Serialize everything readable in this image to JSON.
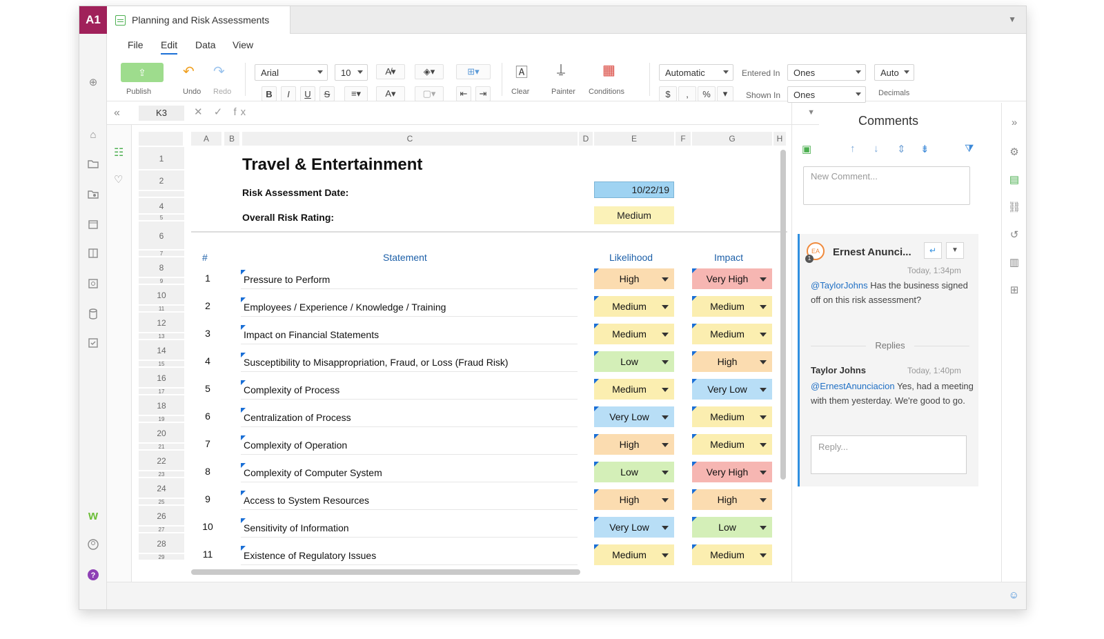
{
  "app": {
    "logo": "A1",
    "doc_title": "Planning and Risk Assessments"
  },
  "menu": [
    "File",
    "Edit",
    "Data",
    "View"
  ],
  "toolbar": {
    "publish": "Publish",
    "undo": "Undo",
    "redo": "Redo",
    "font": "Arial",
    "font_size": "10",
    "clear": "Clear",
    "painter": "Painter",
    "conditions": "Conditions",
    "format": "Automatic",
    "entered_in_label": "Entered In",
    "entered_in_value": "Ones",
    "shown_in_label": "Shown In",
    "shown_in_value": "Ones",
    "decimals_value": "Auto",
    "decimals_label": "Decimals",
    "bold": "B",
    "italic": "I",
    "underline": "U",
    "strike": "S",
    "currency": "$",
    "comma": ",",
    "percent": "%"
  },
  "formula": {
    "cell_ref": "K3",
    "icons": "✕ ✓ fx"
  },
  "columns": [
    "A",
    "B",
    "C",
    "D",
    "E",
    "F",
    "G",
    "H"
  ],
  "row_numbers": [
    "1",
    "2",
    "",
    "4",
    "5",
    "6",
    "7",
    "8",
    "9",
    "10",
    "11",
    "12",
    "13",
    "14",
    "15",
    "16",
    "17",
    "18",
    "19",
    "20",
    "21",
    "22",
    "23",
    "24",
    "25",
    "26",
    "27",
    "28",
    "29"
  ],
  "sheet": {
    "title": "Travel & Entertainment",
    "date_label": "Risk Assessment Date:",
    "date_value": "10/22/19",
    "rating_label": "Overall Risk Rating:",
    "rating_value": "Medium",
    "headers": {
      "num": "#",
      "statement": "Statement",
      "likelihood": "Likelihood",
      "impact": "Impact"
    },
    "rows": [
      {
        "n": "1",
        "s": "Pressure to Perform",
        "l": "High",
        "i": "Very High"
      },
      {
        "n": "2",
        "s": "Employees / Experience / Knowledge / Training",
        "l": "Medium",
        "i": "Medium"
      },
      {
        "n": "3",
        "s": "Impact on Financial Statements",
        "l": "Medium",
        "i": "Medium"
      },
      {
        "n": "4",
        "s": "Susceptibility to Misappropriation, Fraud, or Loss (Fraud Risk)",
        "l": "Low",
        "i": "High"
      },
      {
        "n": "5",
        "s": "Complexity of Process",
        "l": "Medium",
        "i": "Very Low"
      },
      {
        "n": "6",
        "s": "Centralization of Process",
        "l": "Very Low",
        "i": "Medium"
      },
      {
        "n": "7",
        "s": "Complexity of Operation",
        "l": "High",
        "i": "Medium"
      },
      {
        "n": "8",
        "s": "Complexity of Computer System",
        "l": "Low",
        "i": "Very High"
      },
      {
        "n": "9",
        "s": "Access to System Resources",
        "l": "High",
        "i": "High"
      },
      {
        "n": "10",
        "s": "Sensitivity of Information",
        "l": "Very Low",
        "i": "Low"
      },
      {
        "n": "11",
        "s": "Existence of Regulatory Issues",
        "l": "Medium",
        "i": "Medium"
      }
    ]
  },
  "level_colors": {
    "Very High": "#f6b6b2",
    "High": "#fbdcb0",
    "Medium": "#fbeeb0",
    "Low": "#d4efb8",
    "Very Low": "#b8def6"
  },
  "comments": {
    "title": "Comments",
    "new_placeholder": "New Comment...",
    "thread": {
      "avatar": "EA",
      "badge": "1",
      "author": "Ernest Anunci...",
      "time": "Today, 1:34pm",
      "mention": "@TaylorJohns",
      "body": "Has the business signed off on this risk assessment?",
      "replies_label": "Replies",
      "reply_author": "Taylor Johns",
      "reply_time": "Today, 1:40pm",
      "reply_mention": "@ErnestAnunciacion",
      "reply_body": "Yes, had a meeting with them yesterday. We're good to go.",
      "reply_placeholder": "Reply..."
    }
  }
}
